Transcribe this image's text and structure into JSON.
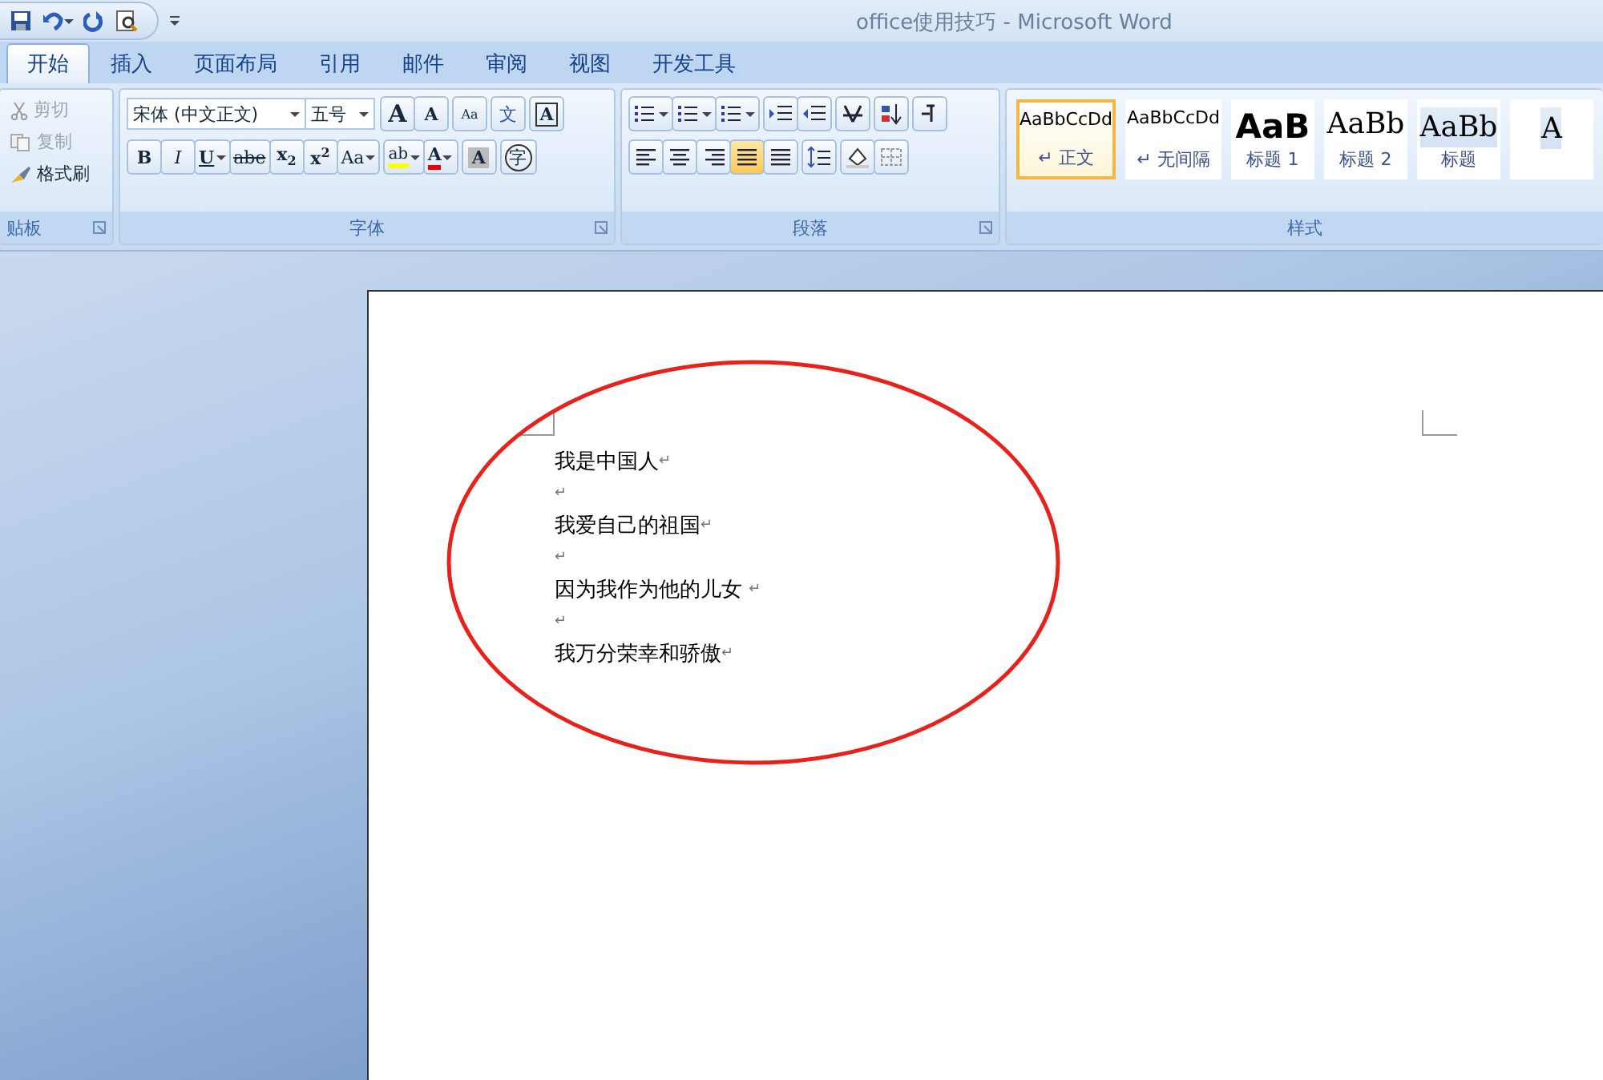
{
  "window": {
    "title": "office使用技巧 - Microsoft Word"
  },
  "tabs": [
    {
      "label": "开始",
      "selected": true
    },
    {
      "label": "插入",
      "selected": false
    },
    {
      "label": "页面布局",
      "selected": false
    },
    {
      "label": "引用",
      "selected": false
    },
    {
      "label": "邮件",
      "selected": false
    },
    {
      "label": "审阅",
      "selected": false
    },
    {
      "label": "视图",
      "selected": false
    },
    {
      "label": "开发工具",
      "selected": false
    }
  ],
  "clipboard": {
    "label": "贴板",
    "items": [
      {
        "label": "剪切",
        "kind": "cut",
        "disabled": true
      },
      {
        "label": "复制",
        "kind": "copy",
        "disabled": true
      },
      {
        "label": "格式刷",
        "kind": "brush",
        "disabled": false
      }
    ]
  },
  "font": {
    "label": "字体",
    "font_name": "宋体 (中文正文)",
    "font_size": "五号",
    "row1": [
      {
        "label": "A",
        "kind": "grow"
      },
      {
        "label": "A",
        "kind": "shrink"
      },
      {
        "label": "Aa",
        "kind": "clear"
      },
      {
        "label": "文",
        "kind": "phonetic"
      },
      {
        "label": "A",
        "kind": "border"
      }
    ],
    "row2": [
      {
        "label": "B",
        "kind": "bold"
      },
      {
        "label": "I",
        "kind": "italic"
      },
      {
        "label": "U",
        "kind": "underline"
      },
      {
        "label": "abe",
        "kind": "strike"
      },
      {
        "label": "x$_{2}$",
        "kind": "plain"
      },
      {
        "label": "x$^{2}$",
        "kind": "plain"
      },
      {
        "label": "Aa",
        "kind": "case"
      },
      {
        "label": "ab",
        "kind": "highlight"
      },
      {
        "label": "A",
        "kind": "color"
      },
      {
        "label": "A",
        "kind": "shade"
      },
      {
        "label": "字",
        "kind": "enclose"
      }
    ]
  },
  "paragraph": {
    "label": "段落",
    "alignments": [
      {
        "kind": "left",
        "selected": false
      },
      {
        "kind": "center",
        "selected": false
      },
      {
        "kind": "right",
        "selected": false
      },
      {
        "kind": "justify",
        "selected": true
      },
      {
        "kind": "distributed",
        "selected": false
      }
    ]
  },
  "styles": {
    "label": "样式",
    "items": [
      {
        "sample": "AaBbCcDd",
        "name": "正文",
        "mark": "↵",
        "kind": "body",
        "selected": true
      },
      {
        "sample": "AaBbCcDd",
        "name": "无间隔",
        "mark": "↵",
        "kind": "body",
        "selected": false
      },
      {
        "sample": "AaB",
        "name": "标题 1",
        "kind": "h1",
        "selected": false
      },
      {
        "sample": "AaBb",
        "name": "标题 2",
        "kind": "h2",
        "selected": false
      },
      {
        "sample": "AaBb",
        "name": "标题",
        "kind": "title",
        "selected": false
      },
      {
        "sample": "A",
        "kind": "title",
        "selected": false
      }
    ]
  },
  "document": {
    "lines": [
      {
        "text": "我是中国人",
        "mark": "↵"
      },
      {
        "mark": "↵"
      },
      {
        "text": "我爱自己的祖国",
        "mark": "↵"
      },
      {
        "mark": "↵"
      },
      {
        "text": "因为我作为他的儿女 ",
        "mark": "↵"
      },
      {
        "mark": "↵"
      },
      {
        "text": "我万分荣幸和骄傲",
        "mark": "↵"
      }
    ]
  }
}
